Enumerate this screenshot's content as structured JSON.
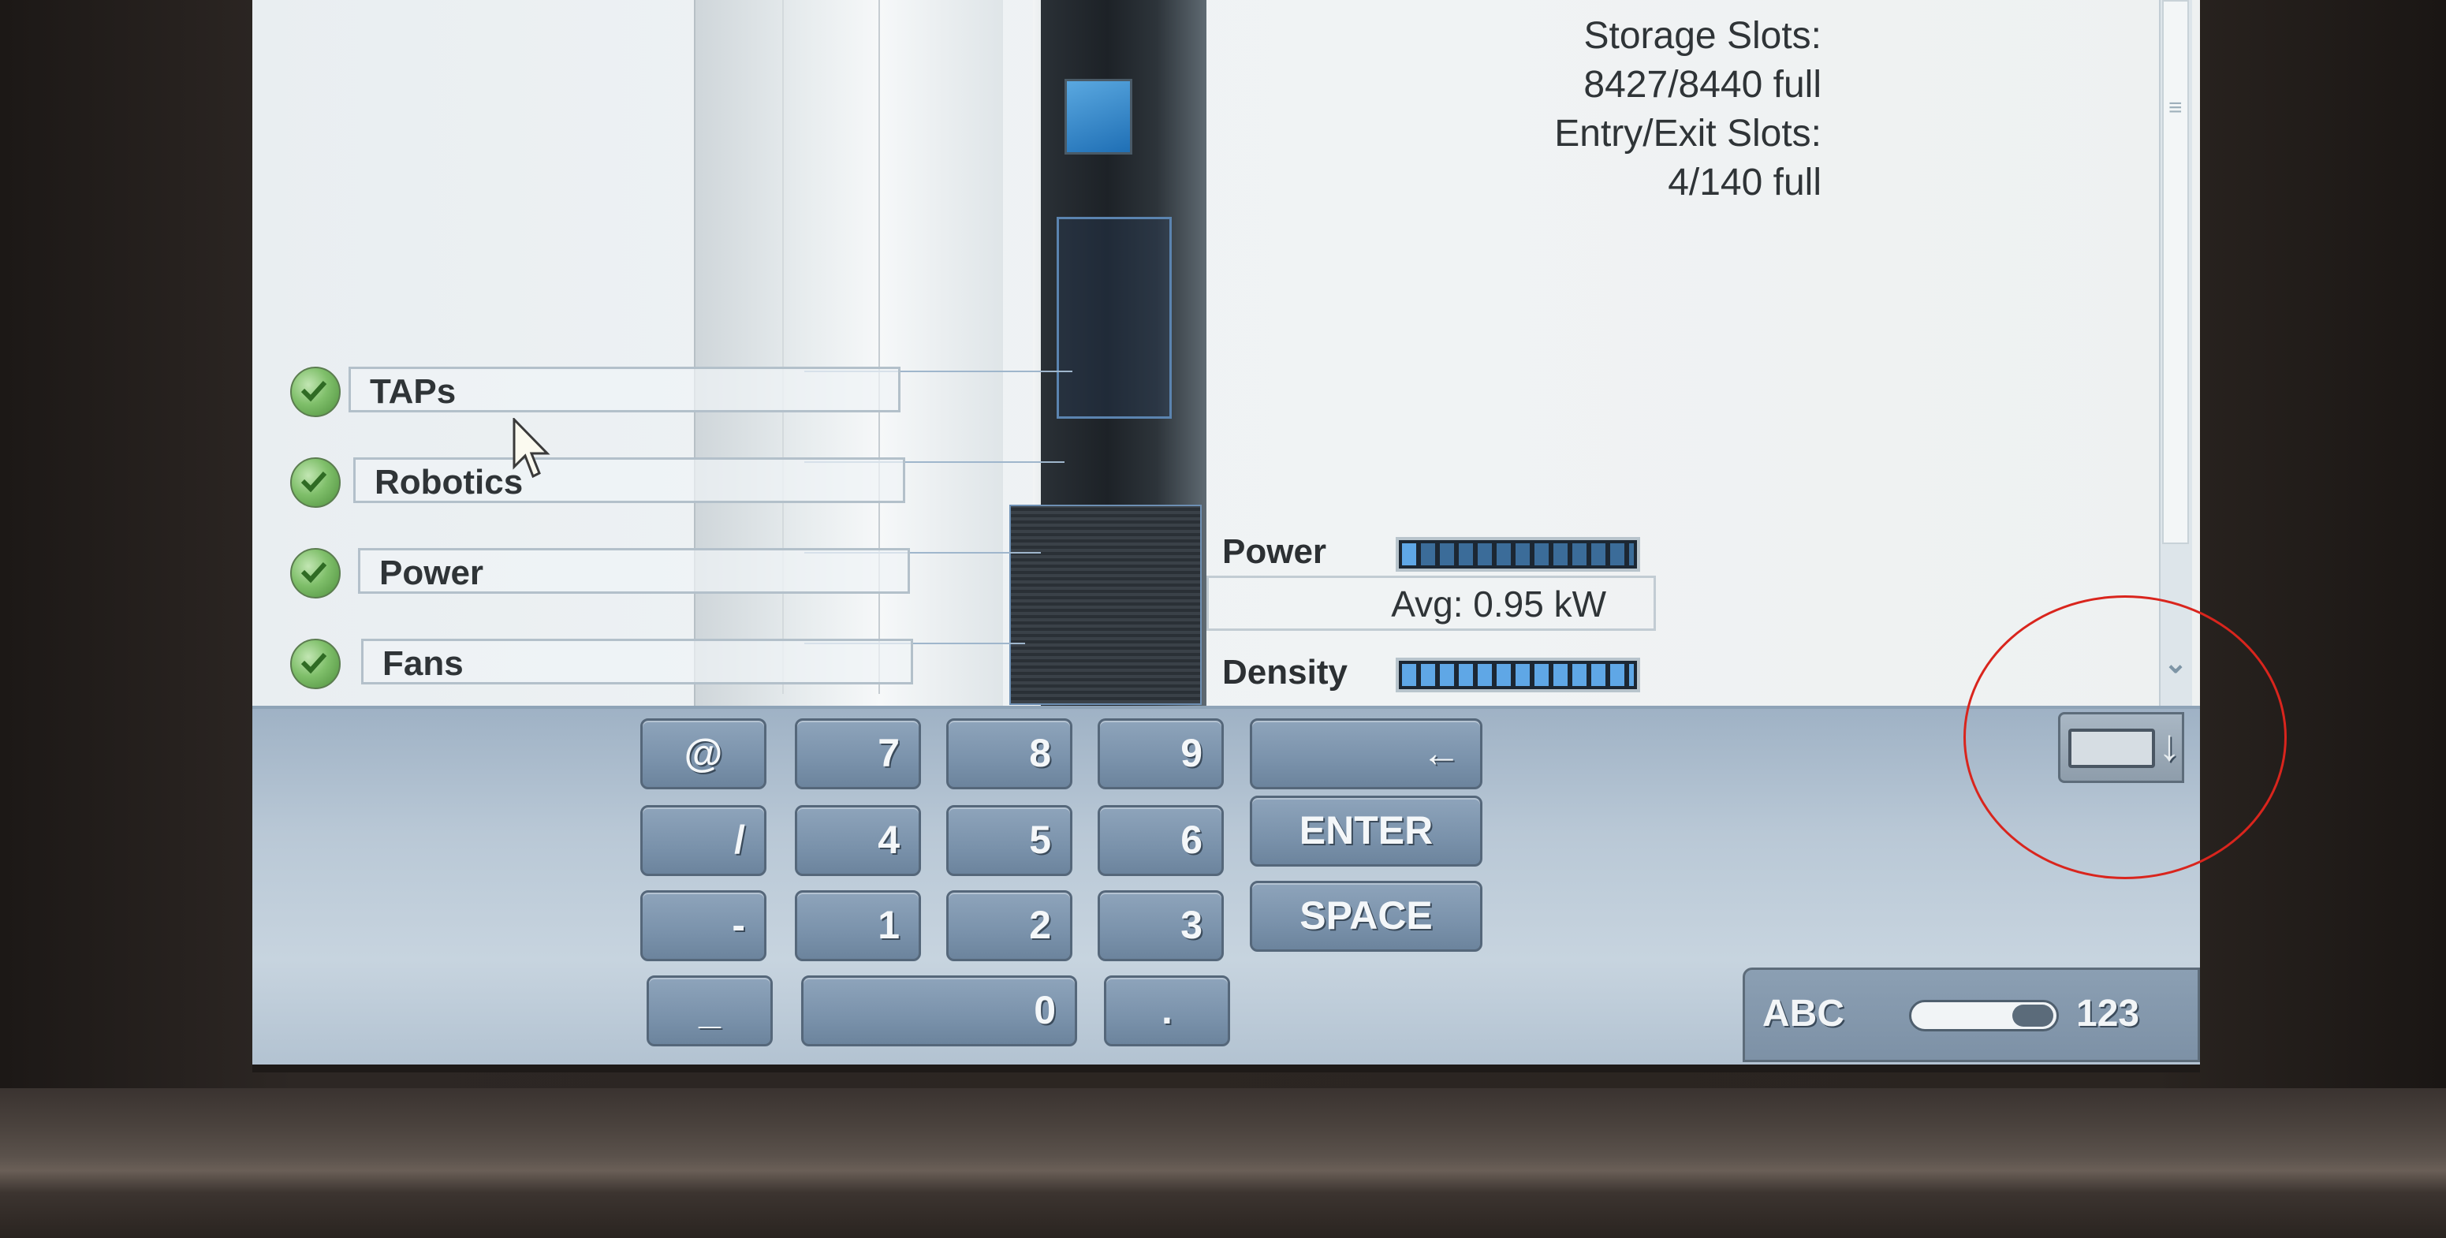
{
  "library_info": {
    "storage_slots_label": "Storage Slots:",
    "storage_slots_value": "8427/8440 full",
    "entry_exit_label": "Entry/Exit Slots:",
    "entry_exit_value": "4/140 full"
  },
  "subsystems": [
    {
      "label": "TAPs",
      "status_icon": "check-icon"
    },
    {
      "label": "Robotics",
      "status_icon": "check-icon"
    },
    {
      "label": "Power",
      "status_icon": "check-icon"
    },
    {
      "label": "Fans",
      "status_icon": "check-icon"
    }
  ],
  "meters": {
    "power": {
      "label": "Power",
      "level_fraction": 0.08,
      "avg_text": "Avg: 0.95 kW"
    },
    "density": {
      "label": "Density",
      "level_fraction": 1.0
    }
  },
  "keypad": {
    "rows": [
      [
        "@",
        "7",
        "8",
        "9"
      ],
      [
        "/",
        "4",
        "5",
        "6"
      ],
      [
        "-",
        "1",
        "2",
        "3"
      ],
      [
        "_",
        "0",
        "."
      ]
    ],
    "backspace_icon": "backspace-arrow-icon",
    "backspace_glyph": "←",
    "enter_label": "ENTER",
    "space_label": "SPACE"
  },
  "keyboard_toggle": {
    "hide_icon": "hide-keyboard-icon",
    "mode_left": "ABC",
    "mode_right": "123",
    "selected_mode": "123"
  },
  "colors": {
    "check_green": "#7fbf6a",
    "meter_blue": "#5fa7e6",
    "annotation_red": "#d9251d",
    "key_blue": "#7a92ab"
  }
}
